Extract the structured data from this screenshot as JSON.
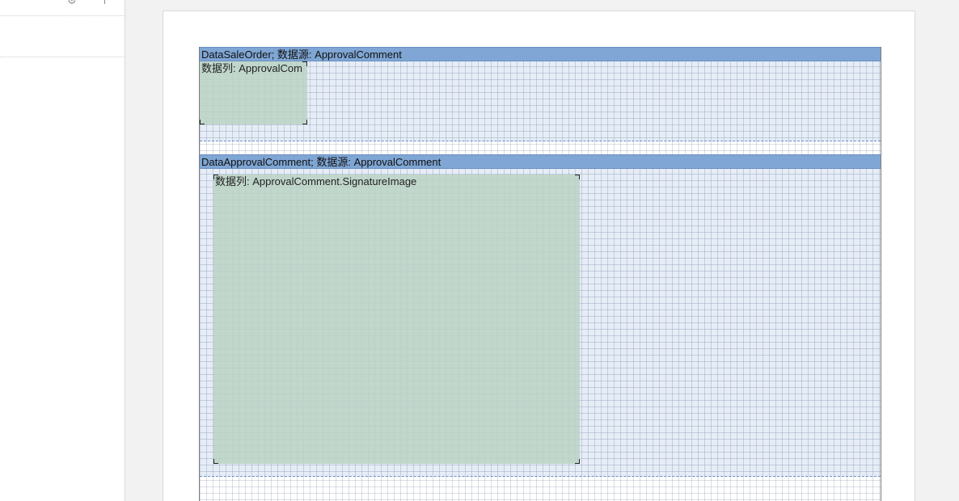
{
  "sidebar": {
    "gear_icon": "gear-icon"
  },
  "report": {
    "bands": [
      {
        "header": "DataSaleOrder; 数据源: ApprovalComment",
        "image_field": "数据列: ApprovalCom"
      },
      {
        "header": "DataApprovalComment; 数据源: ApprovalComment",
        "image_field": "数据列: ApprovalComment.SignatureImage"
      }
    ]
  },
  "colors": {
    "band_header": "#7fa6d4",
    "band_body": "#e6edf6",
    "image_box": "#bad2c4",
    "canvas_bg": "#f2f2f2"
  }
}
